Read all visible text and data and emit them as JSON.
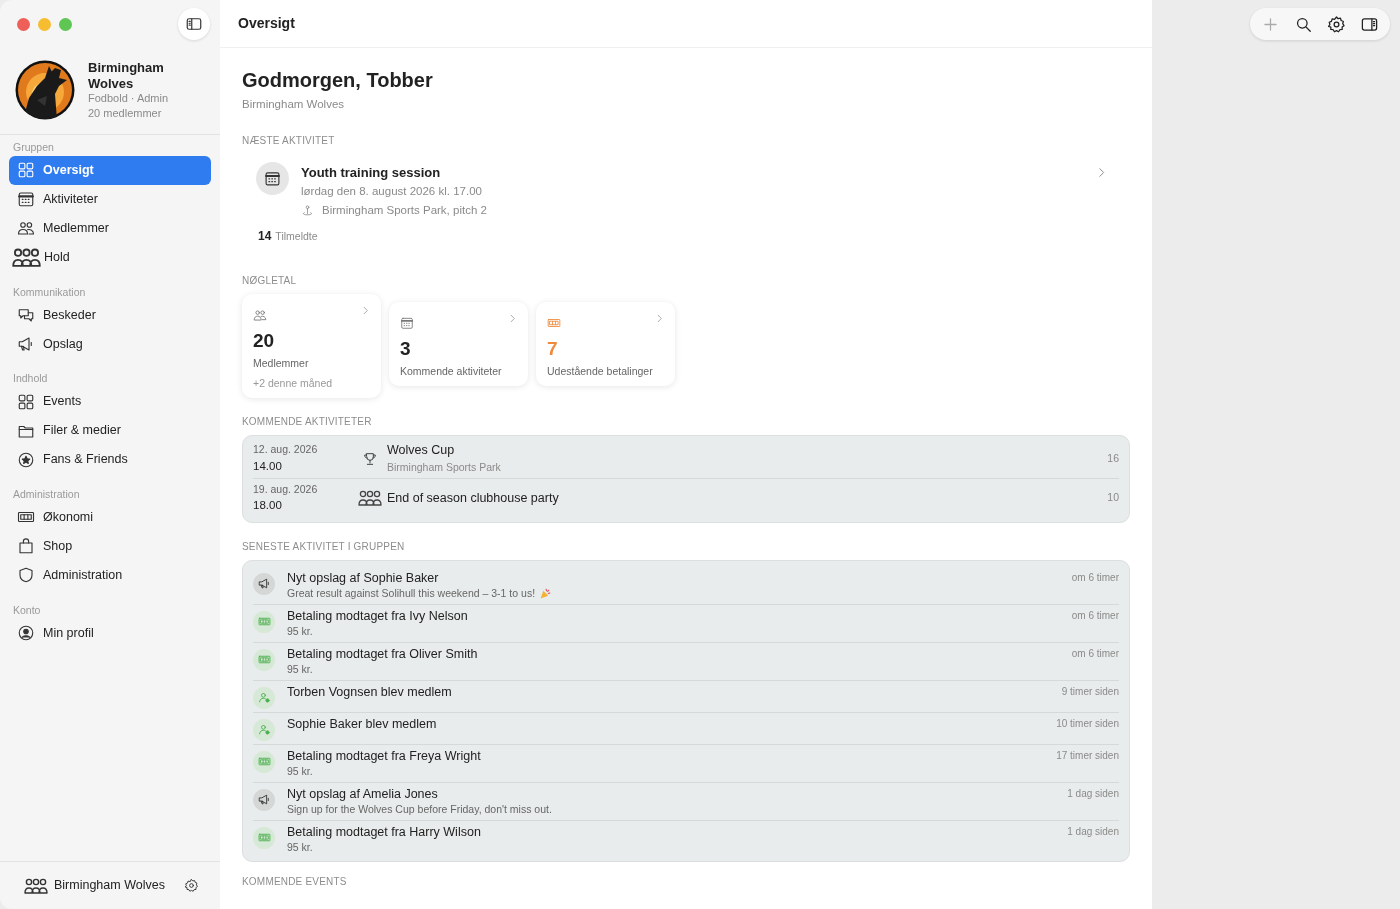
{
  "window": {
    "title": "Oversigt"
  },
  "sidebar": {
    "club": {
      "name": "Birmingham Wolves",
      "meta": "Fodbold · Admin",
      "members": "20 medlemmer"
    },
    "sections": [
      {
        "title": "Gruppen",
        "items": [
          {
            "label": "Oversigt",
            "selected": true
          },
          {
            "label": "Aktiviteter",
            "selected": false
          },
          {
            "label": "Medlemmer",
            "selected": false
          },
          {
            "label": "Hold",
            "selected": false
          }
        ]
      },
      {
        "title": "Kommunikation",
        "items": [
          {
            "label": "Beskeder",
            "selected": false
          },
          {
            "label": "Opslag",
            "selected": false
          }
        ]
      },
      {
        "title": "Indhold",
        "items": [
          {
            "label": "Events",
            "selected": false
          },
          {
            "label": "Filer & medier",
            "selected": false
          },
          {
            "label": "Fans & Friends",
            "selected": false
          }
        ]
      },
      {
        "title": "Administration",
        "items": [
          {
            "label": "Økonomi",
            "selected": false
          },
          {
            "label": "Shop",
            "selected": false
          },
          {
            "label": "Administration",
            "selected": false
          }
        ]
      },
      {
        "title": "Konto",
        "items": [
          {
            "label": "Min profil",
            "selected": false
          }
        ]
      }
    ],
    "footer": {
      "label": "Birmingham Wolves"
    }
  },
  "greeting": {
    "title": "Godmorgen, Tobber",
    "subtitle": "Birmingham Wolves"
  },
  "next_activity": {
    "heading": "NÆSTE AKTIVITET",
    "title": "Youth training session",
    "datetime": "lørdag den 8. august 2026 kl. 17.00",
    "location": "Birmingham Sports Park, pitch 2",
    "count": "14",
    "count_label": "Tilmeldte"
  },
  "key_figures": {
    "heading": "NØGLETAL",
    "cards": [
      {
        "value": "20",
        "label": "Medlemmer",
        "note": "+2 denne måned",
        "kind": "normal"
      },
      {
        "value": "3",
        "label": "Kommende aktiviteter",
        "kind": "normal"
      },
      {
        "value": "7",
        "label": "Udestående betalinger",
        "kind": "warning"
      }
    ]
  },
  "upcoming": {
    "heading": "KOMMENDE AKTIVITETER",
    "rows": [
      {
        "kind": "match",
        "date": "12. aug. 2026",
        "time": "14.00",
        "title": "Wolves Cup",
        "location": "Birmingham Sports Park",
        "count": "16"
      },
      {
        "kind": "social",
        "date": "19. aug. 2026",
        "time": "18.00",
        "title": "End of season clubhouse party",
        "count": "10"
      }
    ]
  },
  "recent": {
    "heading": "SENESTE AKTIVITET I GRUPPEN",
    "items": [
      {
        "kind": "post",
        "title": "Nyt opslag af Sophie Baker",
        "detail": "Great result against Solihull this weekend – 3-1 to us!",
        "time": "om 6 timer"
      },
      {
        "kind": "payment",
        "title": "Betaling modtaget fra Ivy Nelson",
        "detail": "95 kr.",
        "time": "om 6 timer"
      },
      {
        "kind": "payment",
        "title": "Betaling modtaget fra Oliver Smith",
        "detail": "95 kr.",
        "time": "om 6 timer"
      },
      {
        "kind": "member",
        "title": "Torben Vognsen blev medlem",
        "time": "9 timer siden"
      },
      {
        "kind": "member",
        "title": "Sophie Baker blev medlem",
        "time": "10 timer siden"
      },
      {
        "kind": "payment",
        "title": "Betaling modtaget fra Freya Wright",
        "detail": "95 kr.",
        "time": "17 timer siden"
      },
      {
        "kind": "post",
        "title": "Nyt opslag af Amelia Jones",
        "detail": "Sign up for the Wolves Cup before Friday, don't miss out.",
        "time": "1 dag siden"
      },
      {
        "kind": "payment",
        "title": "Betaling modtaget fra Harry Wilson",
        "detail": "95 kr.",
        "time": "1 dag siden"
      }
    ]
  },
  "next_section": {
    "heading": "KOMMENDE EVENTS"
  }
}
